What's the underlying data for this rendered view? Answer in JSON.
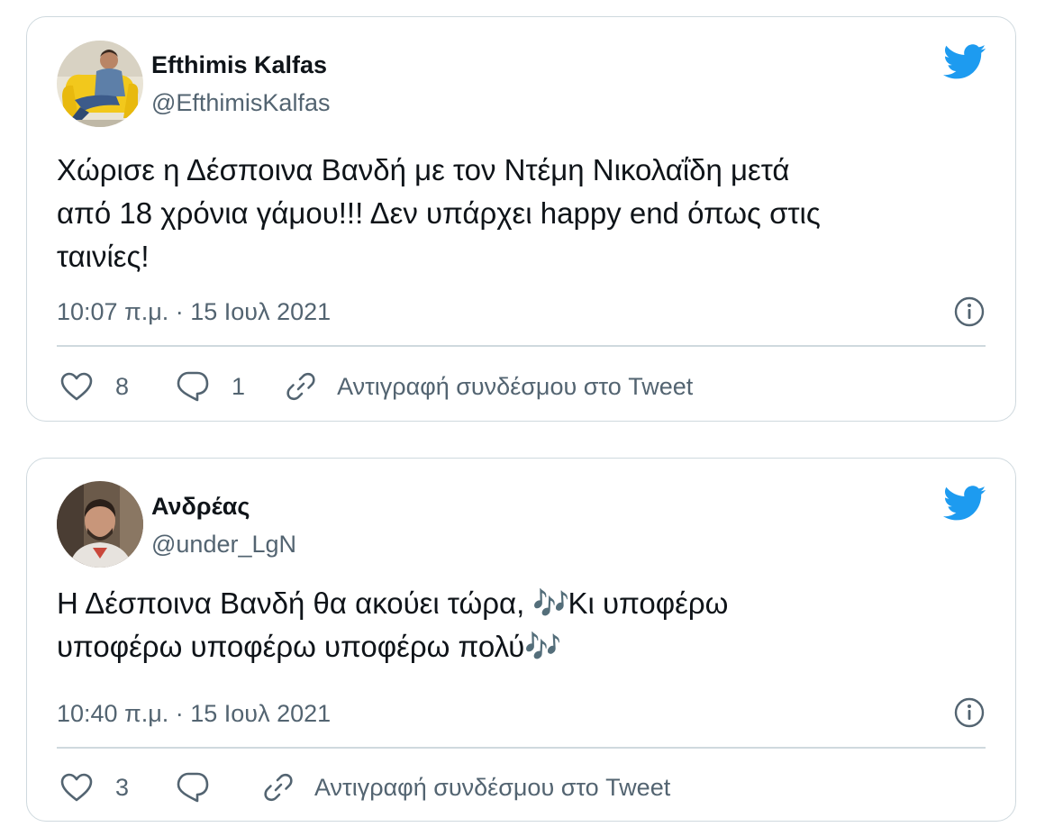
{
  "tweets": [
    {
      "author_name": "Efthimis Kalfas",
      "author_handle": "@EfthimisKalfas",
      "text_lines": [
        "Χώρισε η Δέσποινα Βανδή με τον Ντέμη Νικολαΐδη μετά",
        "από 18 χρόνια γάμου!!! Δεν υπάρχει happy end όπως στις",
        "ταινίες!"
      ],
      "timestamp": "10:07 π.μ. · 15 Ιουλ 2021",
      "like_count": "8",
      "reply_count": "1",
      "copy_link_label": "Αντιγραφή συνδέσμου στο Tweet"
    },
    {
      "author_name": "Ανδρέας",
      "author_handle": "@under_LgN",
      "text_line1_before": "Η Δέσποινα Βανδή θα ακούει τώρα, ",
      "text_line1_after": "Κι υποφέρω",
      "text_line2": "υποφέρω υποφέρω υποφέρω πολύ",
      "music_emoji": "🎶",
      "timestamp": "10:40 π.μ. · 15 Ιουλ 2021",
      "like_count": "3",
      "copy_link_label": "Αντιγραφή συνδέσμου στο Tweet"
    }
  ],
  "icons": {
    "brand": "twitter-bird-icon",
    "like": "heart-icon",
    "reply": "reply-bubble-icon",
    "copy": "link-icon",
    "info": "info-icon"
  },
  "colors": {
    "twitter_blue": "#1d9bf0",
    "secondary_text": "#536471",
    "border": "#cfd9de",
    "primary_text": "#0f1419"
  }
}
